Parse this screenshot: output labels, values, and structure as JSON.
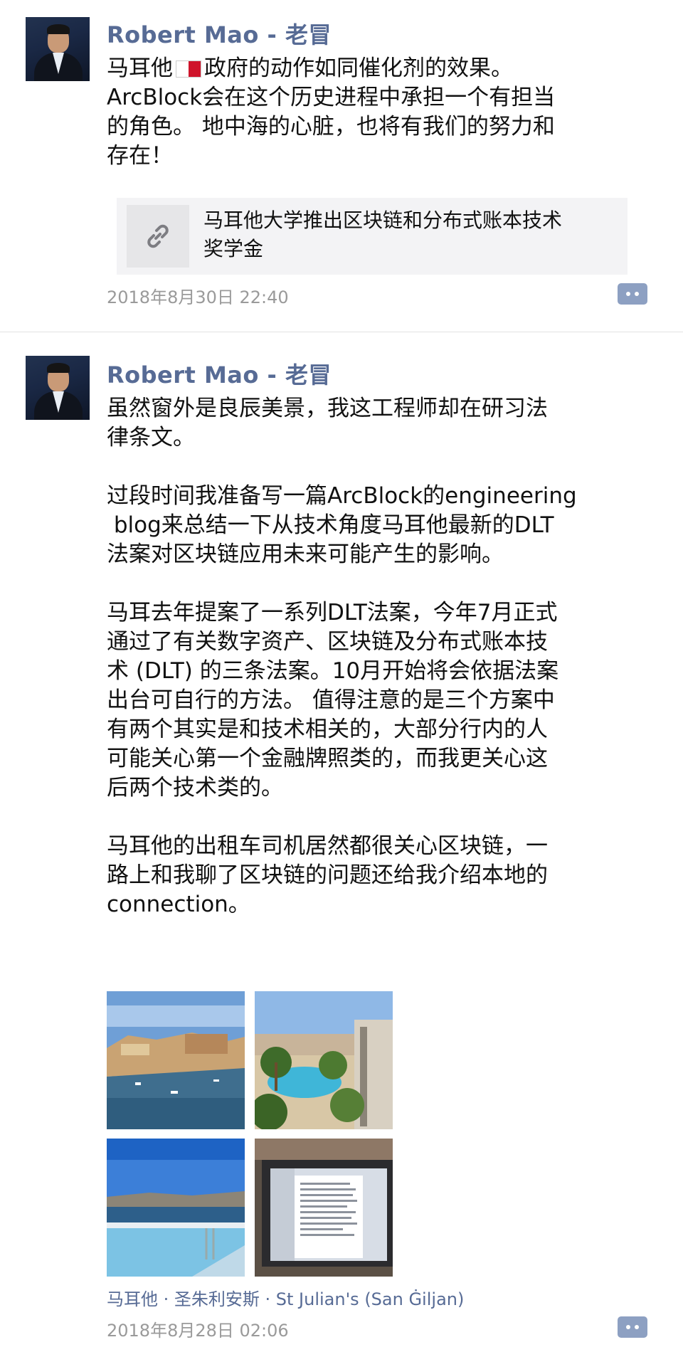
{
  "posts": [
    {
      "author": "Robert Mao - 老冒",
      "text_before_flag": "马耳他",
      "flag": "malta-flag-icon",
      "text_after_flag": "政府的动作如同催化剂的效果。\nArcBlock会在这个历史进程中承担一个有担当\n的角色。 地中海的心脏，也将有我们的努力和\n存在！",
      "link_title": "马耳他大学推出区块链和分布式账本技术\n奖学金",
      "timestamp": "2018年8月30日 22:40"
    },
    {
      "author": "Robert Mao - 老冒",
      "text": "虽然窗外是良辰美景，我这工程师却在研习法\n律条文。\n\n过段时间我准备写一篇ArcBlock的engineering\n blog来总结一下从技术角度马耳他最新的DLT\n法案对区块链应用未来可能产生的影响。\n\n马耳去年提案了一系列DLT法案，今年7月正式\n通过了有关数字资产、区块链及分布式账本技\n术 (DLT) 的三条法案。10月开始将会依据法案\n出台可自行的方法。 值得注意的是三个方案中\n有两个其实是和技术相关的，大部分行内的人\n可能关心第一个金融牌照类的，而我更关心这\n后两个技术类的。\n\n马耳他的出租车司机居然都很关心区块链，一\n路上和我聊了区块链的问题还给我介绍本地的\nconnection。",
      "photos": [
        "harbor-photo",
        "pool-palms-photo",
        "infinity-pool-photo",
        "laptop-document-photo"
      ],
      "location": "马耳他 · 圣朱利安斯 · St Julian's (San Ġiljan)",
      "timestamp": "2018年8月28日 02:06"
    }
  ],
  "colors": {
    "author": "#576b95",
    "meta": "#9a9a9a",
    "comment_button": "#8da0c2"
  }
}
